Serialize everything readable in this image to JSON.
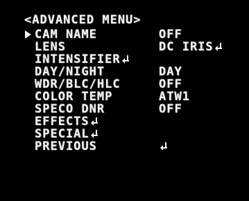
{
  "menu": {
    "title": "<ADVANCED MENU>",
    "items": [
      {
        "label": "CAM NAME",
        "value": "OFF",
        "selected": true
      },
      {
        "label": "LENS",
        "value": "DC IRIS",
        "value_enter_icon": true
      },
      {
        "label": "INTENSIFIER",
        "label_enter_icon": true
      },
      {
        "label": "DAY/NIGHT",
        "value": "DAY"
      },
      {
        "label": "WDR/BLC/HLC",
        "value": "OFF"
      },
      {
        "label": "COLOR TEMP",
        "value": "ATW1"
      },
      {
        "label": "SPECO DNR",
        "value": "OFF"
      },
      {
        "label": "EFFECTS",
        "label_enter_icon": true
      },
      {
        "label": "SPECIAL",
        "label_enter_icon": true
      },
      {
        "label": "PREVIOUS",
        "value_enter_icon": true
      }
    ]
  },
  "colors": {
    "background": "#000000",
    "text": "#f2f2f2"
  },
  "icons": {
    "cursor": "triangle-pointer-icon",
    "enter": "enter-return-icon"
  }
}
